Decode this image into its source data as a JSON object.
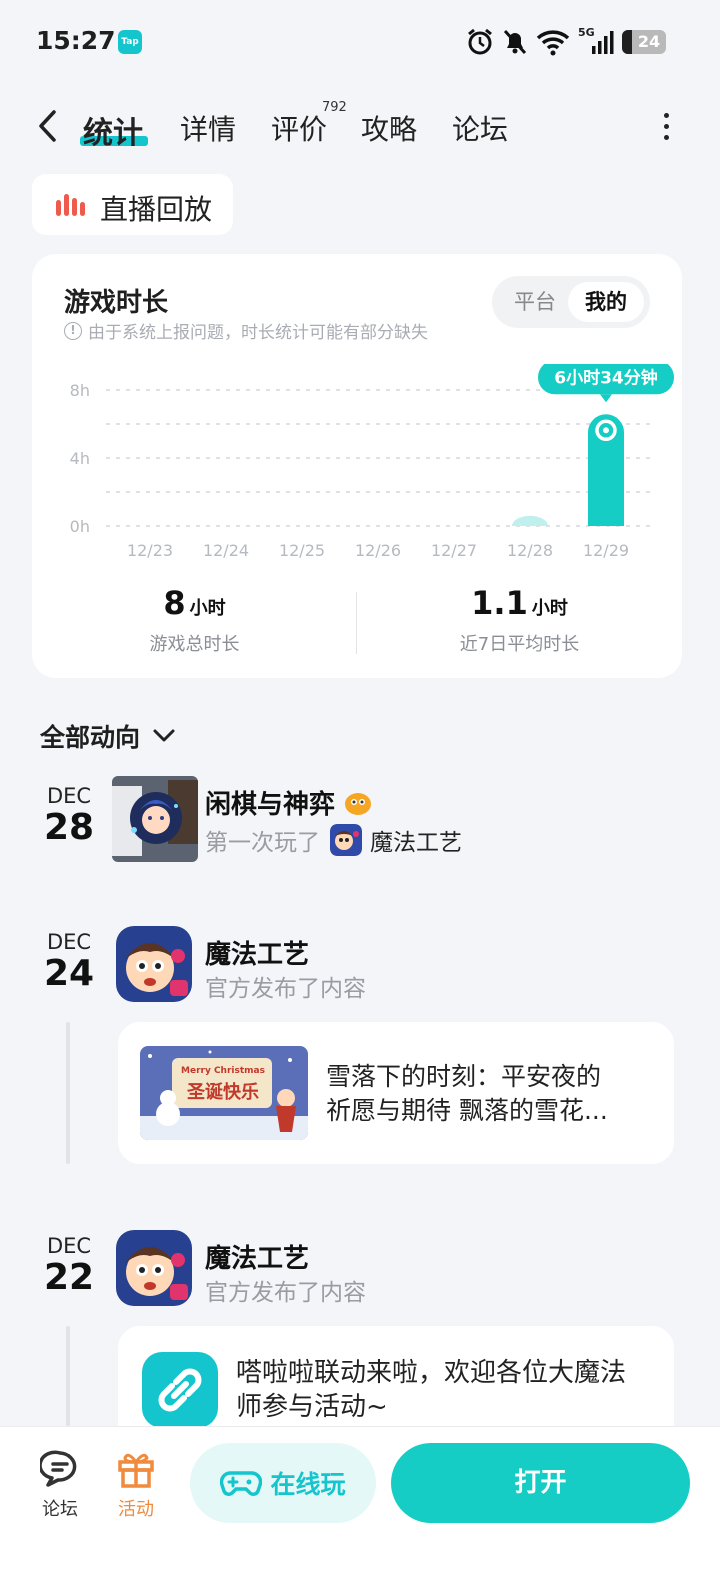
{
  "status_bar": {
    "time": "15:27",
    "app_badge": "Tap",
    "battery": "24",
    "signal_label": "5G"
  },
  "nav": {
    "tabs": [
      {
        "label": "统计",
        "active": true
      },
      {
        "label": "详情"
      },
      {
        "label": "评价",
        "count": "792"
      },
      {
        "label": "攻略"
      },
      {
        "label": "论坛"
      }
    ]
  },
  "replay": {
    "label": "直播回放"
  },
  "stats": {
    "title": "游戏时长",
    "note": "由于系统上报问题，时长统计可能有部分缺失",
    "toggle": {
      "options": [
        "平台",
        "我的"
      ],
      "selected": "我的"
    },
    "total": {
      "value": "8",
      "unit": "小时",
      "label": "游戏总时长"
    },
    "average": {
      "value": "1.1",
      "unit": "小时",
      "label": "近7日平均时长"
    }
  },
  "chart_data": {
    "type": "bar",
    "categories": [
      "12/23",
      "12/24",
      "12/25",
      "12/26",
      "12/27",
      "12/28",
      "12/29"
    ],
    "values": [
      0,
      0,
      0,
      0,
      0,
      0.6,
      6.57
    ],
    "y_ticks": [
      "0h",
      "4h",
      "8h"
    ],
    "ylim": [
      0,
      8
    ],
    "highlight_label": "6小时34分钟",
    "grid": true
  },
  "feed": {
    "header": "全部动向",
    "items": [
      {
        "month": "DEC",
        "day": "28",
        "name": "闲棋与神弈",
        "sub": "第一次玩了",
        "game": "魔法工艺"
      },
      {
        "month": "DEC",
        "day": "24",
        "name": "魔法工艺",
        "sub": "官方发布了内容",
        "post": "雪落下的时刻：平安夜的祈愿与期待 飘落的雪花...",
        "post_line1": "雪落下的时刻：平安夜的",
        "post_line2": "祈愿与期待 飘落的雪花...",
        "thumb_text": "圣诞快乐",
        "thumb_sub": "Merry Christmas"
      },
      {
        "month": "DEC",
        "day": "22",
        "name": "魔法工艺",
        "sub": "官方发布了内容",
        "post_line1": "嗒啦啦联动来啦，欢迎各位大魔法",
        "post_line2": "师参与活动~"
      }
    ]
  },
  "bottom": {
    "forum": "论坛",
    "activity": "活动",
    "online": "在线玩",
    "open": "打开"
  },
  "colors": {
    "accent": "#15c5ce",
    "live_red": "#ee5b4d",
    "activity_orange": "#f08a3c"
  }
}
